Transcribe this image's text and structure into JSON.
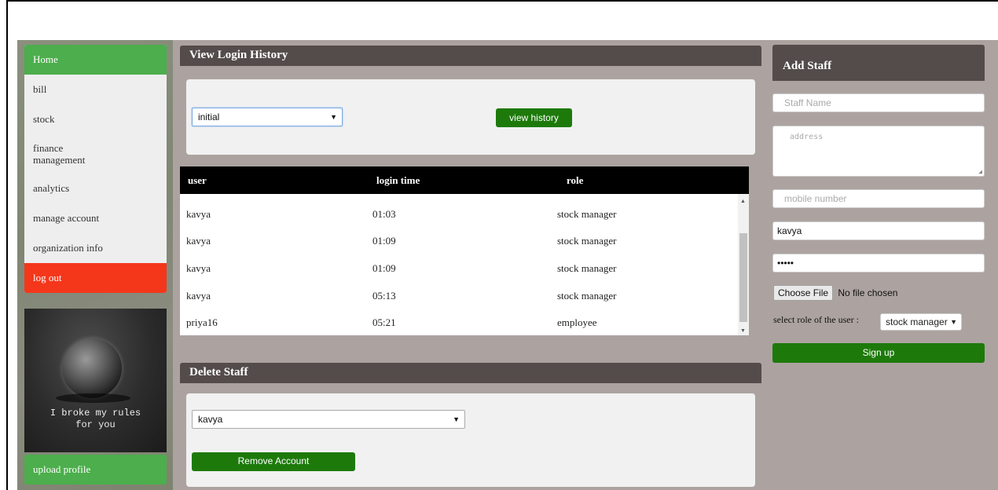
{
  "sidebar": {
    "items": [
      {
        "label": "Home"
      },
      {
        "label": "bill"
      },
      {
        "label": "stock"
      },
      {
        "label": "finance management"
      },
      {
        "label": "analytics"
      },
      {
        "label": "manage account"
      },
      {
        "label": "organization info"
      },
      {
        "label": "log out"
      }
    ],
    "profile_quote": "I broke my rules\nfor you",
    "upload_label": "upload profile"
  },
  "login_history": {
    "title": "View Login History",
    "selected_user": "initial",
    "view_button": "view history",
    "columns": [
      "user",
      "login time",
      "role"
    ],
    "rows": [
      {
        "user": "kavya",
        "time": "01:03",
        "role": "stock manager"
      },
      {
        "user": "kavya",
        "time": "01:09",
        "role": "stock manager"
      },
      {
        "user": "kavya",
        "time": "01:09",
        "role": "stock manager"
      },
      {
        "user": "kavya",
        "time": "05:13",
        "role": "stock manager"
      },
      {
        "user": "priya16",
        "time": "05:21",
        "role": "employee"
      }
    ]
  },
  "delete_staff": {
    "title": "Delete Staff",
    "selected_user": "kavya",
    "remove_button": "Remove Account"
  },
  "add_staff": {
    "title": "Add Staff",
    "staff_name_placeholder": "Staff Name",
    "address_placeholder": "address",
    "mobile_placeholder": "mobile number",
    "username_value": "kavya",
    "password_value": "•••••",
    "file_button": "Choose File",
    "file_status": "No file chosen",
    "role_label": "select role of the user :",
    "role_value": "stock manager",
    "signup_button": "Sign up"
  },
  "colors": {
    "home": "#4cae4c",
    "logout": "#f4371b",
    "header": "#534c4a",
    "button": "#1d7a0a",
    "page_bg": "#aca3a0"
  },
  "icons": [
    "dropdown-arrow-icon",
    "scroll-up-icon",
    "scroll-down-icon",
    "resize-handle-icon"
  ]
}
